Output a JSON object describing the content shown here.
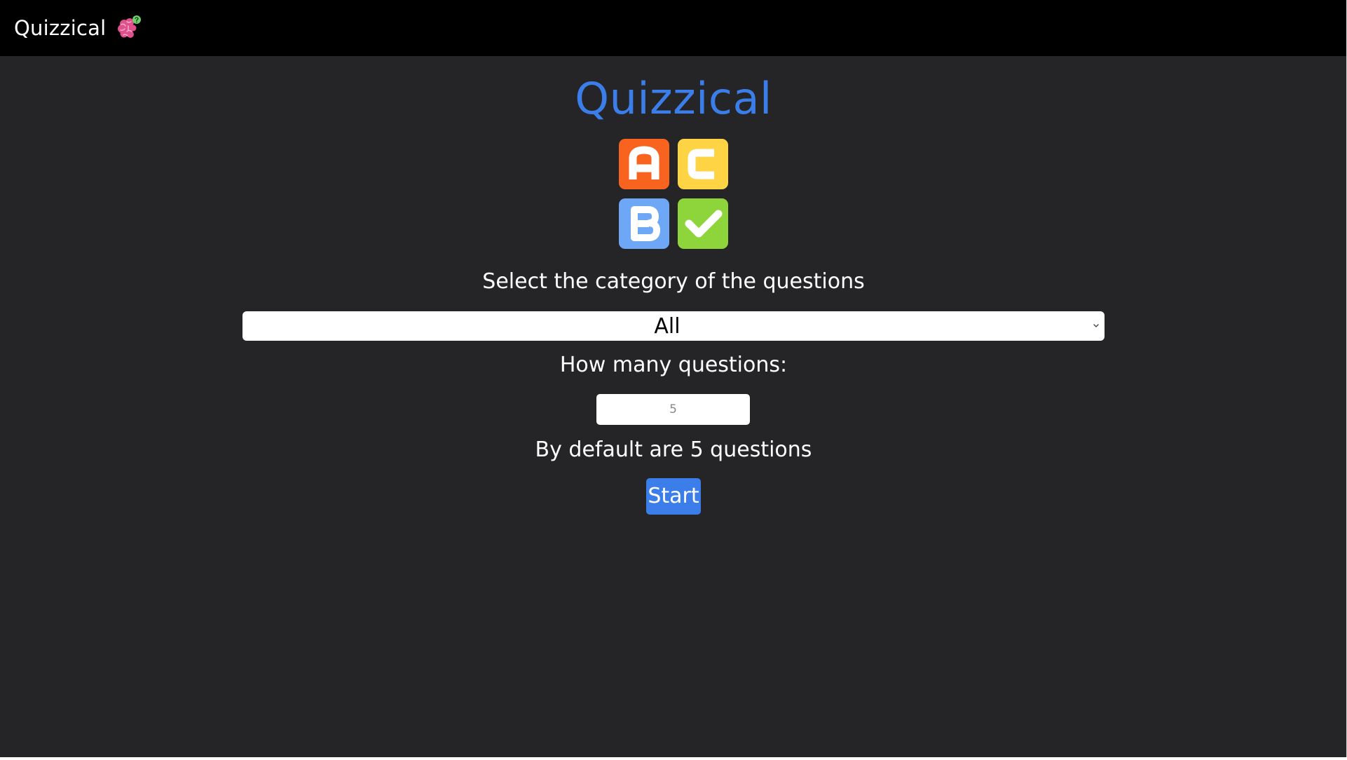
{
  "navbar": {
    "brand_name": "Quizzical",
    "brand_icon": "brain-question-icon"
  },
  "main": {
    "title": "Quizzical",
    "logo_icon": "abc-quiz-logo",
    "logo_tiles": [
      "A",
      "C",
      "B",
      "check"
    ],
    "category_label": "Select the category of the questions",
    "category_selected": "All",
    "count_label": "How many questions:",
    "count_placeholder": "5",
    "default_note": "By default are 5 questions",
    "start_label": "Start"
  },
  "colors": {
    "page_background": "#252527",
    "navbar_background": "#000000",
    "accent": "#3b7de9",
    "tile_orange": "#f96320",
    "tile_yellow": "#fed444",
    "tile_blue": "#6da7f5",
    "tile_green": "#8ed53b",
    "brain_pink": "#e0508b"
  }
}
